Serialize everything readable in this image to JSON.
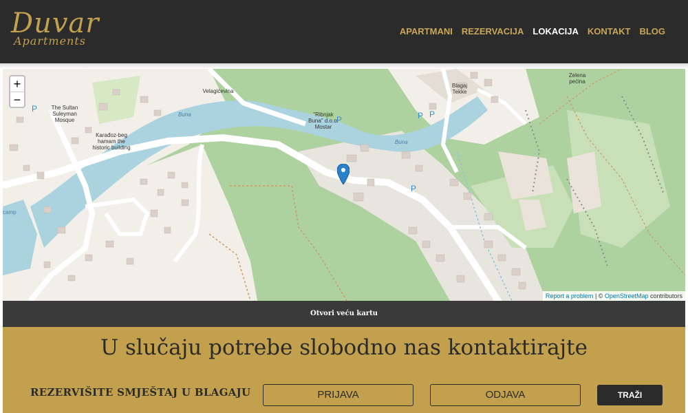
{
  "brand": {
    "name": "Duvar",
    "subtitle": "Apartments",
    "color": "#c2a04e"
  },
  "nav": {
    "items": [
      {
        "label": "APARTMANI",
        "active": false
      },
      {
        "label": "REZERVACIJA",
        "active": false
      },
      {
        "label": "LOKACIJA",
        "active": true
      },
      {
        "label": "KONTAKT",
        "active": false
      },
      {
        "label": "BLOG",
        "active": false
      }
    ]
  },
  "map": {
    "zoom_in": "+",
    "zoom_out": "−",
    "labels": {
      "mosque": "The Sultan Suleyman Mosque",
      "velagicevina": "Velagićevina",
      "ribnjak": "\"Ribnjak Buna\" d.o.o. Mostar",
      "buna1": "Buna",
      "buna2": "Buna",
      "karadoz": "Karađoz-beg hamam the historic building",
      "blagaj": "Blagaj Tekke",
      "zelena": "Zelena pećina",
      "camp": "camp"
    },
    "parking": [
      "P",
      "P",
      "P",
      "P",
      "P"
    ],
    "attribution": {
      "report": "Report a problem",
      "sep": " | © ",
      "osm": "OpenStreetMap",
      "contributors": " contributors"
    }
  },
  "open_map": {
    "label": "Otvori veću kartu"
  },
  "contact": {
    "title": "U slučaju potrebe slobodno nas kontaktirajte",
    "reserve_label": "REZERVIŠITE SMJEŠTAJ U BLAGAJU",
    "checkin_placeholder": "PRIJAVA",
    "checkout_placeholder": "ODJAVA",
    "search_label": "TRAŽI"
  },
  "colors": {
    "header_bg": "#2b2b2b",
    "gold": "#c2a04e",
    "nav_text": "#c9a75a",
    "active_nav": "#ffffff",
    "bar_bg": "#3a3a3a"
  }
}
